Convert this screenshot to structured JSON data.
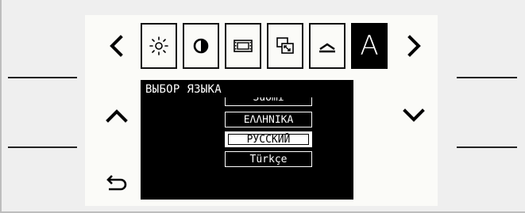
{
  "icons": {
    "back": "chevron-left-icon",
    "forward": "chevron-right-icon",
    "up": "chevron-up-icon",
    "down": "chevron-down-icon",
    "return": "return-arrow-icon",
    "tabs": [
      "brightness-icon",
      "contrast-icon",
      "picture-frame-icon",
      "picture-in-picture-icon",
      "tilt-icon",
      "language-icon"
    ]
  },
  "tabs": {
    "language_label": "A",
    "active_index": 5
  },
  "panel": {
    "title": "ВЫБОР ЯЗЫКА"
  },
  "language_list": {
    "items": [
      "Suomi",
      "ΕΛΛΗΝΙΚΑ",
      "РУССКИЙ",
      "Türkçe"
    ],
    "selected": "РУССКИЙ"
  },
  "colors": {
    "background": "#efefef",
    "screen": "#fbfbf8",
    "panel": "#000000",
    "text_on_panel": "#ffffff"
  }
}
